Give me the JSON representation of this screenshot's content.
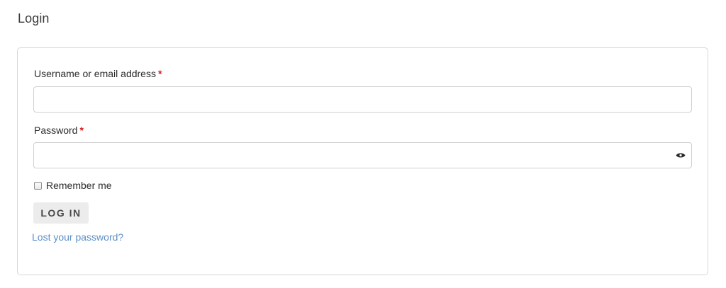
{
  "page": {
    "title": "Login"
  },
  "form": {
    "username": {
      "label": "Username or email address",
      "required_marker": "*",
      "value": "",
      "placeholder": ""
    },
    "password": {
      "label": "Password",
      "required_marker": "*",
      "value": "",
      "placeholder": "",
      "toggle_icon": "eye-icon"
    },
    "remember": {
      "label": "Remember me",
      "checked": false
    },
    "submit_label": "LOG IN",
    "lost_password_link": "Lost your password?"
  },
  "colors": {
    "required": "#d21f1f",
    "link": "#5d8fc6",
    "button_bg": "#ececec",
    "card_border": "#d7d7d7"
  }
}
